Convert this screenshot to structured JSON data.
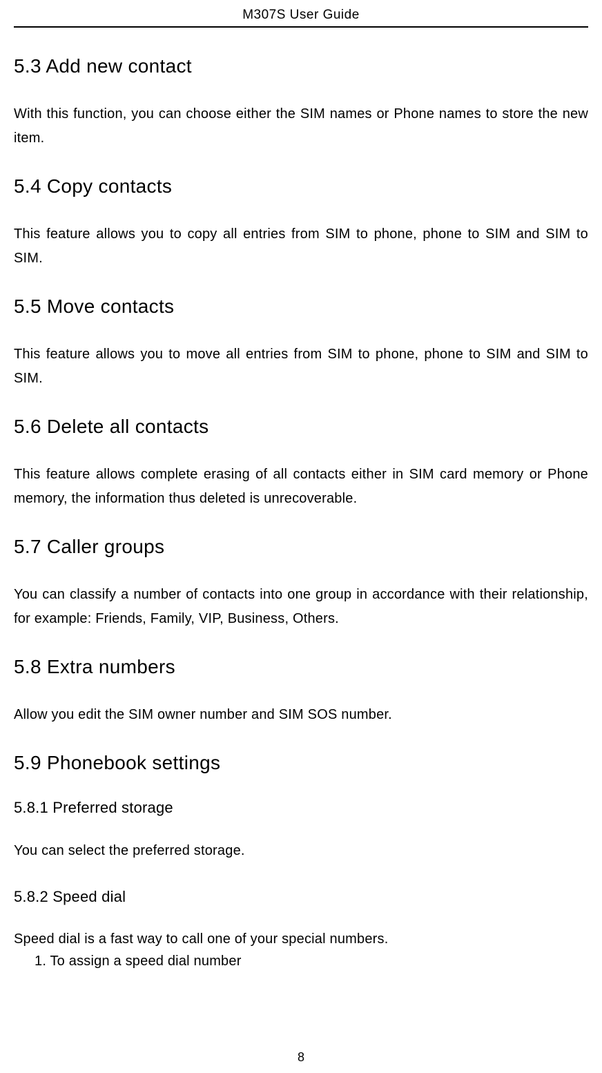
{
  "header": {
    "title": "M307S User Guide"
  },
  "sections": [
    {
      "heading": "5.3 Add new contact",
      "body": "With this function, you can choose either the SIM names or Phone names to store the new item."
    },
    {
      "heading": "5.4 Copy contacts",
      "body": "This feature allows you to copy all entries from SIM to phone, phone to SIM and SIM to SIM."
    },
    {
      "heading": "5.5 Move contacts",
      "body": "This feature allows you to move all entries from SIM to phone, phone to SIM and SIM to SIM."
    },
    {
      "heading": "5.6 Delete all contacts",
      "body": "This feature allows complete erasing of all contacts either in SIM card memory or Phone memory, the information thus deleted is unrecoverable."
    },
    {
      "heading": "5.7 Caller groups",
      "body": "You can classify a number of contacts into one group in accordance with their relationship, for example: Friends, Family, VIP, Business, Others."
    },
    {
      "heading": "5.8 Extra numbers",
      "body": "Allow you edit the SIM owner number and SIM SOS number."
    },
    {
      "heading": "5.9 Phonebook settings",
      "body": ""
    }
  ],
  "subsections": [
    {
      "heading": "5.8.1 Preferred storage",
      "body": "You can select the preferred storage."
    },
    {
      "heading": "5.8.2 Speed dial",
      "body": "Speed dial is a fast way to call one of your special numbers.",
      "list_item": "1.   To assign a speed dial number"
    }
  ],
  "page_number": "8"
}
